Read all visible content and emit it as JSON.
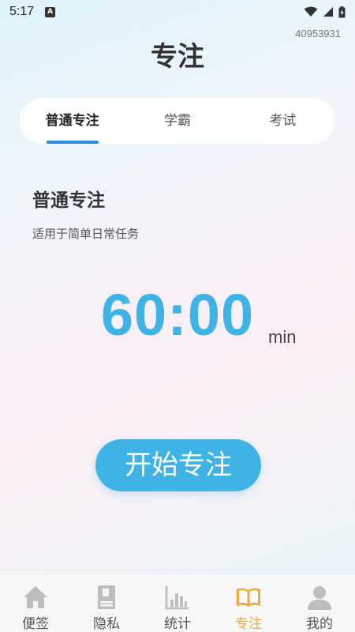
{
  "status_bar": {
    "time": "5:17",
    "app_icon_letter": "A"
  },
  "header": {
    "title": "专注",
    "user_id": "40953931"
  },
  "tabs": [
    {
      "label": "普通专注",
      "active": true
    },
    {
      "label": "学霸",
      "active": false
    },
    {
      "label": "考试",
      "active": false
    }
  ],
  "mode": {
    "title": "普通专注",
    "description": "适用于简单日常任务"
  },
  "timer": {
    "value": "60:00",
    "unit": "min"
  },
  "start_button": {
    "label": "开始专注"
  },
  "bottom_nav": [
    {
      "label": "便签",
      "icon": "home-icon",
      "active": false
    },
    {
      "label": "隐私",
      "icon": "lock-book-icon",
      "active": false
    },
    {
      "label": "统计",
      "icon": "bar-chart-icon",
      "active": false
    },
    {
      "label": "专注",
      "icon": "open-book-icon",
      "active": true
    },
    {
      "label": "我的",
      "icon": "person-icon",
      "active": false
    }
  ],
  "colors": {
    "accent": "#3fb3e6",
    "tab_indicator": "#2d8ee6",
    "nav_active": "#f2a93b"
  }
}
